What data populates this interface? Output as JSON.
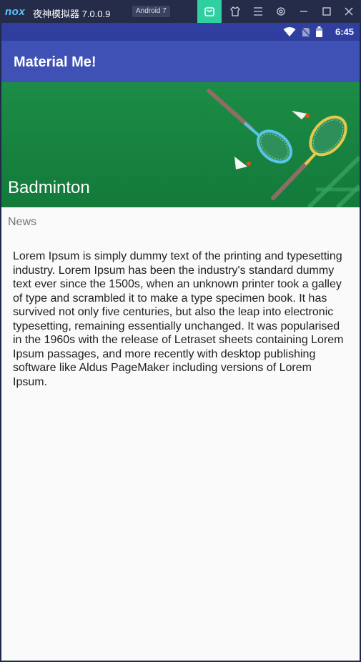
{
  "emulator": {
    "logo": "nox",
    "title": "夜神模拟器 7.0.0.9",
    "badge": "Android 7",
    "icons": [
      "shop-icon",
      "shirt-icon",
      "menu-icon",
      "gear-icon",
      "minimize-icon",
      "maximize-icon",
      "close-icon"
    ]
  },
  "status_bar": {
    "time": "6:45",
    "icons": [
      "wifi-icon",
      "no-sim-icon",
      "battery-icon"
    ]
  },
  "app_bar": {
    "title": "Material Me!"
  },
  "card": {
    "title": "Badminton",
    "subtitle": "News",
    "body": "Lorem Ipsum is simply dummy text of the printing and typesetting industry. Lorem Ipsum has been the industry's standard dummy text ever since the 1500s, when an unknown printer took a galley of type and scrambled it to make a type specimen book. It has survived not only five centuries, but also the leap into electronic typesetting, remaining essentially unchanged. It was popularised in the 1960s with the release of Letraset sheets containing Lorem Ipsum passages, and more recently with desktop publishing software like Aldus PageMaker including versions of Lorem Ipsum."
  },
  "colors": {
    "primary": "#3f51b5",
    "primary_dark": "#303f9f",
    "hero_green": "#1c8c46",
    "accent": "#2fcfa0"
  }
}
